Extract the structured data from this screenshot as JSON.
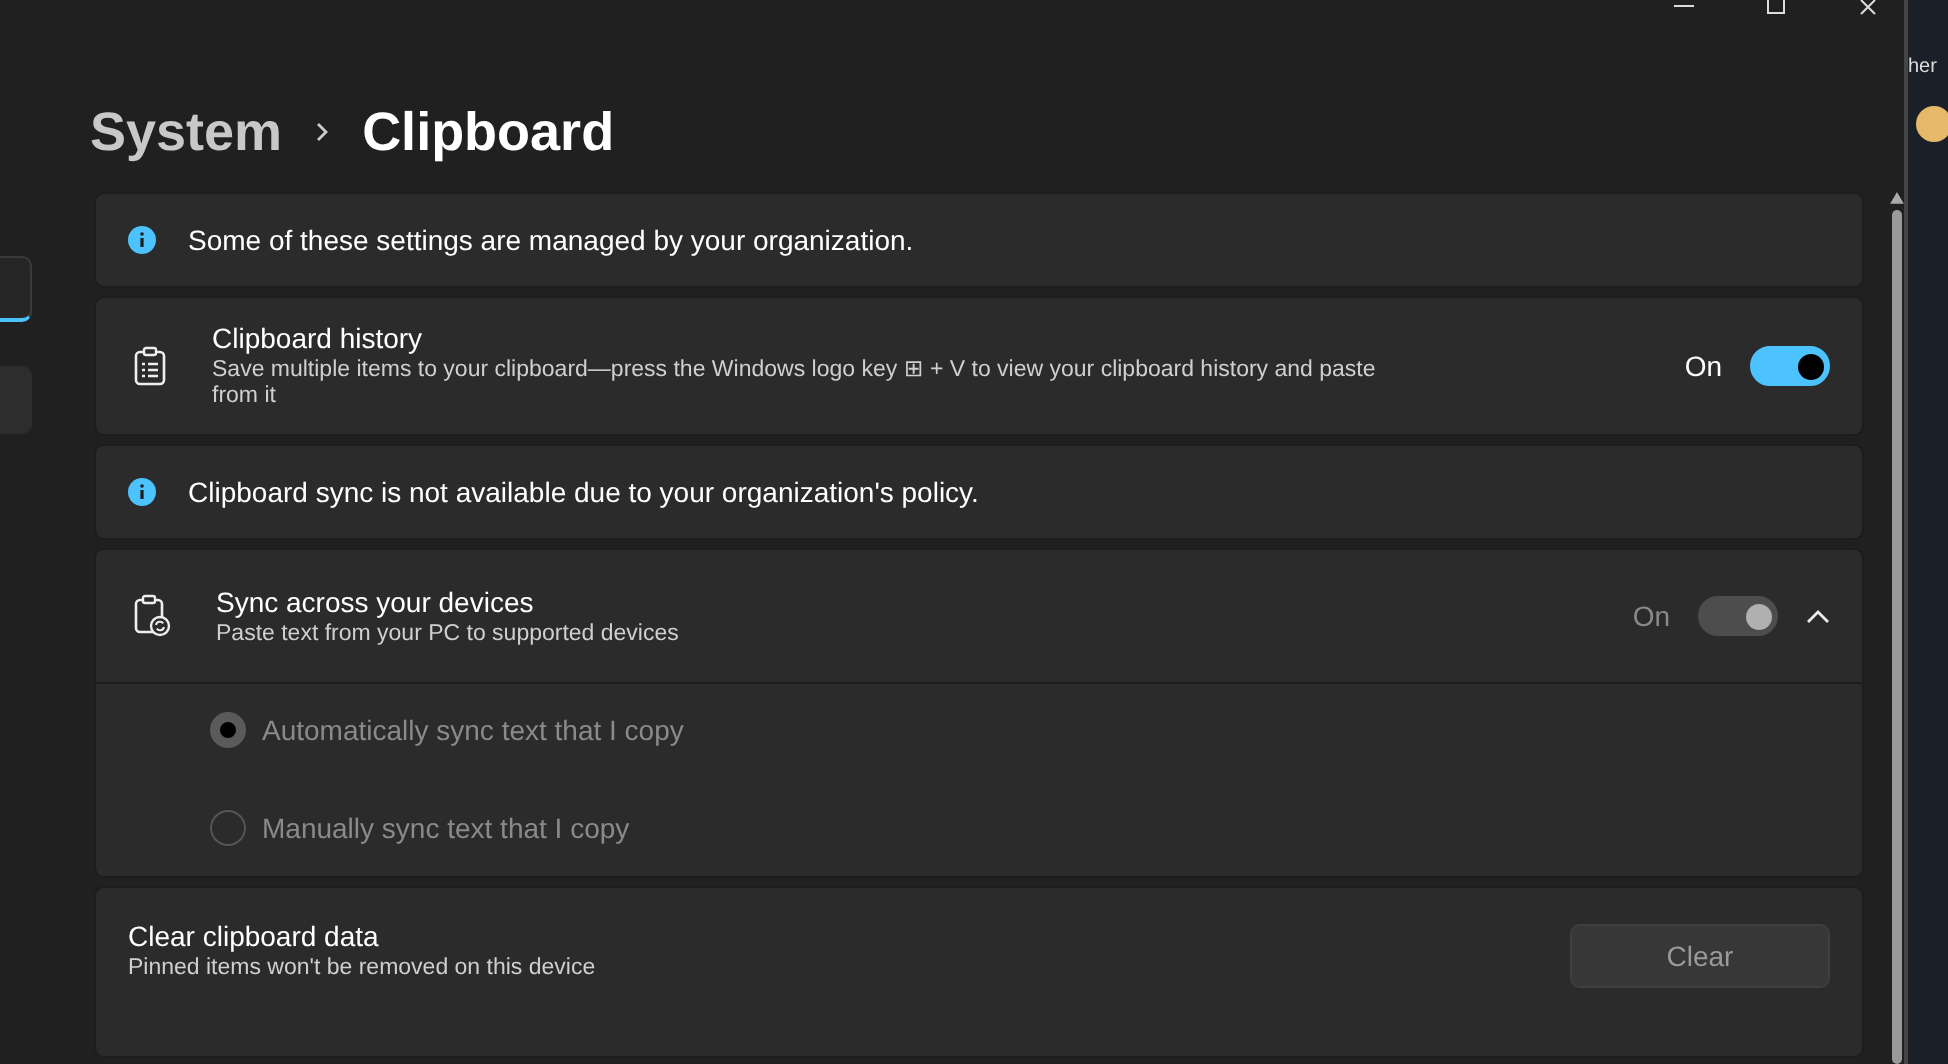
{
  "breadcrumb": {
    "parent": "System",
    "current": "Clipboard"
  },
  "sections": [
    {
      "kind": "info",
      "text": "Some of these settings are managed by your organization."
    },
    {
      "kind": "toggle",
      "title": "Clipboard history",
      "description": "Save multiple items to your clipboard—press the Windows logo key ⊞ + V to view your clipboard history and paste from it",
      "state_label": "On",
      "on": true,
      "disabled": false
    },
    {
      "kind": "info",
      "text": "Clipboard sync is not available due to your organization's policy."
    },
    {
      "kind": "expander",
      "title": "Sync across your devices",
      "description": "Paste text from your PC to supported devices",
      "state_label": "On",
      "on": true,
      "disabled": true,
      "expanded": true,
      "options": [
        {
          "label": "Automatically sync text that I copy",
          "selected": true,
          "disabled": true
        },
        {
          "label": "Manually sync text that I copy",
          "selected": false,
          "disabled": true
        }
      ]
    },
    {
      "kind": "action",
      "title": "Clear clipboard data",
      "description": "Pinned items won't be removed on this device",
      "button": "Clear"
    }
  ],
  "side_window": {
    "text": "her"
  }
}
